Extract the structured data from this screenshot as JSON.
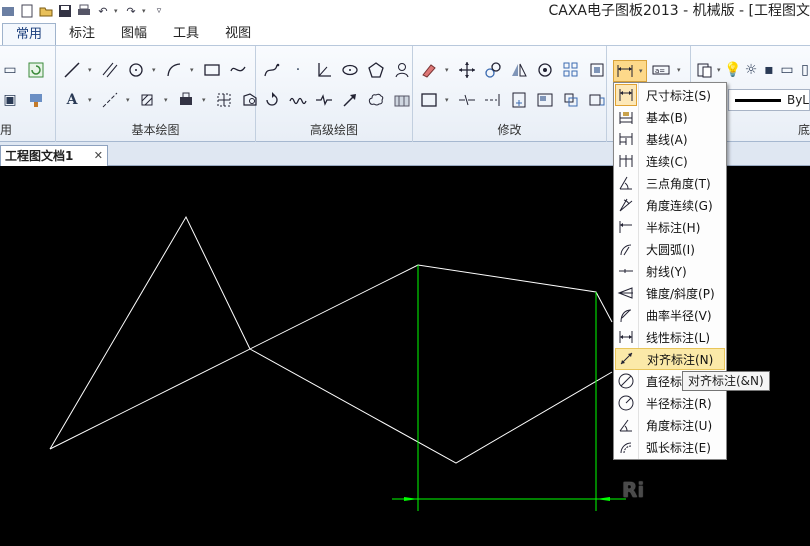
{
  "window": {
    "title": "CAXA电子图板2013 - 机械版 - [工程图文"
  },
  "tabs": [
    {
      "label": "常用",
      "active": true
    },
    {
      "label": "标注"
    },
    {
      "label": "图幅"
    },
    {
      "label": "工具"
    },
    {
      "label": "视图"
    }
  ],
  "ribbon": {
    "groups": {
      "common_partial": "用",
      "basic_draw": "基本绘图",
      "advanced_draw": "高级绘图",
      "modify": "修改",
      "right_partial": "底"
    },
    "linetype_value": "ByL"
  },
  "document": {
    "tab_label": "工程图文档1",
    "close_glyph": "✕"
  },
  "dimension_menu": {
    "items": [
      {
        "label": "尺寸标注(S)",
        "icon": "dim-linear-icon"
      },
      {
        "label": "基本(B)",
        "icon": "dim-basic-icon"
      },
      {
        "label": "基线(A)",
        "icon": "dim-baseline-icon"
      },
      {
        "label": "连续(C)",
        "icon": "dim-continuous-icon"
      },
      {
        "label": "三点角度(T)",
        "icon": "dim-three-point-angle-icon"
      },
      {
        "label": "角度连续(G)",
        "icon": "dim-angle-continuous-icon"
      },
      {
        "label": "半标注(H)",
        "icon": "dim-half-icon"
      },
      {
        "label": "大圆弧(I)",
        "icon": "dim-large-arc-icon"
      },
      {
        "label": "射线(Y)",
        "icon": "dim-ray-icon"
      },
      {
        "label": "锥度/斜度(P)",
        "icon": "dim-taper-icon"
      },
      {
        "label": "曲率半径(V)",
        "icon": "dim-curvature-icon"
      },
      {
        "label": "线性标注(L)",
        "icon": "dim-linear-line-icon"
      },
      {
        "label": "对齐标注(N)",
        "icon": "dim-aligned-icon",
        "highlighted": true
      },
      {
        "label": "直径标",
        "icon": "dim-diameter-icon"
      },
      {
        "label": "半径标注(R)",
        "icon": "dim-radius-icon"
      },
      {
        "label": "角度标注(U)",
        "icon": "dim-angle-icon"
      },
      {
        "label": "弧长标注(E)",
        "icon": "dim-arc-length-icon"
      }
    ]
  },
  "tooltip": {
    "text": "对齐标注(&N)"
  },
  "canvas": {
    "dim_text_preview": "Ri",
    "line_color": "#ffffff",
    "dimension_color": "#00ff00"
  },
  "colors": {
    "accent_highlight": "#fbe9a8",
    "ribbon_bg": "#e8eef6"
  }
}
